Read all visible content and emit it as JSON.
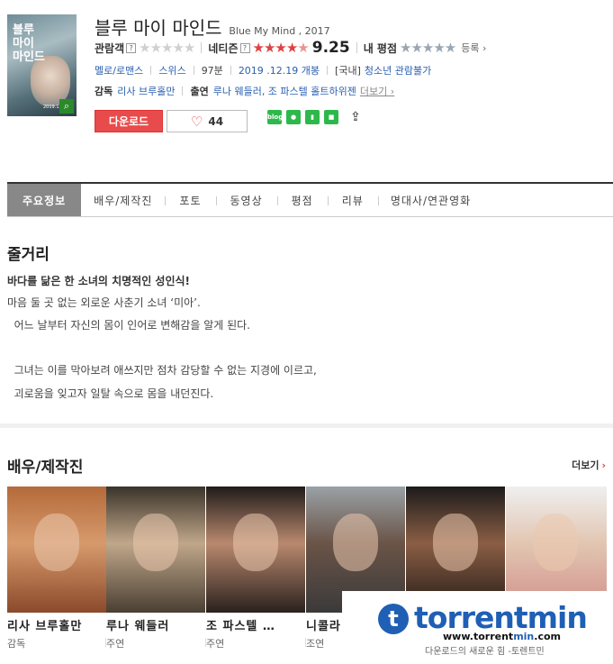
{
  "movie": {
    "poster_title": "블루\n마이\n마인드",
    "poster_date": "2019.12",
    "title_ko": "블루 마이 마인드",
    "title_en": "Blue My Mind , 2017"
  },
  "ratings": {
    "audience_label": "관람객",
    "netizen_label": "네티즌",
    "netizen_score": "9.25",
    "my_rating_label": "내 평점",
    "register_label": "등록",
    "audience_stars": "★★★★★",
    "netizen_stars_filled": "★★★★",
    "netizen_stars_empty": "★",
    "my_stars": "★★★★★"
  },
  "meta": {
    "genre": "멜로/로맨스",
    "country": "스위스",
    "runtime": "97분",
    "release": "2019 .12.19 개봉",
    "grade_prefix": "[국내]",
    "grade": "청소년 관람불가"
  },
  "people": {
    "director_label": "감독",
    "director": "리사 브루홀만",
    "cast_label": "출연",
    "cast": "루나 웨들러, 조 파스텔 홀트하위젠",
    "more": "더보기"
  },
  "actions": {
    "download": "다운로드",
    "like_count": "44",
    "share_labels": [
      "blog",
      "talk",
      "band",
      "cafe"
    ]
  },
  "tabs": [
    "주요정보",
    "배우/제작진",
    "포토",
    "동영상",
    "평점",
    "리뷰",
    "명대사/연관영화"
  ],
  "synopsis": {
    "title": "줄거리",
    "headline": "바다를 닮은 한 소녀의 치명적인 성인식!",
    "lines": [
      "마음 둘 곳 없는 외로운 사춘기 소녀 ‘미아’.",
      "  어느 날부터 자신의 몸이 인어로 변해감을 알게 된다.",
      "",
      "  그녀는 이를 막아보려 애쓰지만 점차 감당할 수 없는 지경에 이르고,",
      "  괴로움을 잊고자 일탈 속으로 몸을 내던진다."
    ]
  },
  "cast_section": {
    "title": "배우/제작진",
    "more": "더보기",
    "members": [
      {
        "name": "리사 브루홀만",
        "role": "감독"
      },
      {
        "name": "루나 웨들러",
        "role": "주연"
      },
      {
        "name": "조 파스텔 …",
        "role": "주연"
      },
      {
        "name": "니콜라",
        "role": "조연"
      },
      {
        "name": "",
        "role": ""
      },
      {
        "name": "",
        "role": ""
      }
    ]
  },
  "watermark": {
    "logo_letter": "t",
    "brand": "torrentmin",
    "url_prefix": "www.torrent",
    "url_highlight": "min",
    "url_suffix": ".com",
    "slogan": "다운로드의 새로운 힘 -토렌트민"
  },
  "colors": {
    "accent_red": "#e84b4b",
    "star_red": "#e04040",
    "link_blue": "#2a5fb0",
    "brand_blue": "#1f5fb5",
    "share_green": "#2eb84b"
  }
}
